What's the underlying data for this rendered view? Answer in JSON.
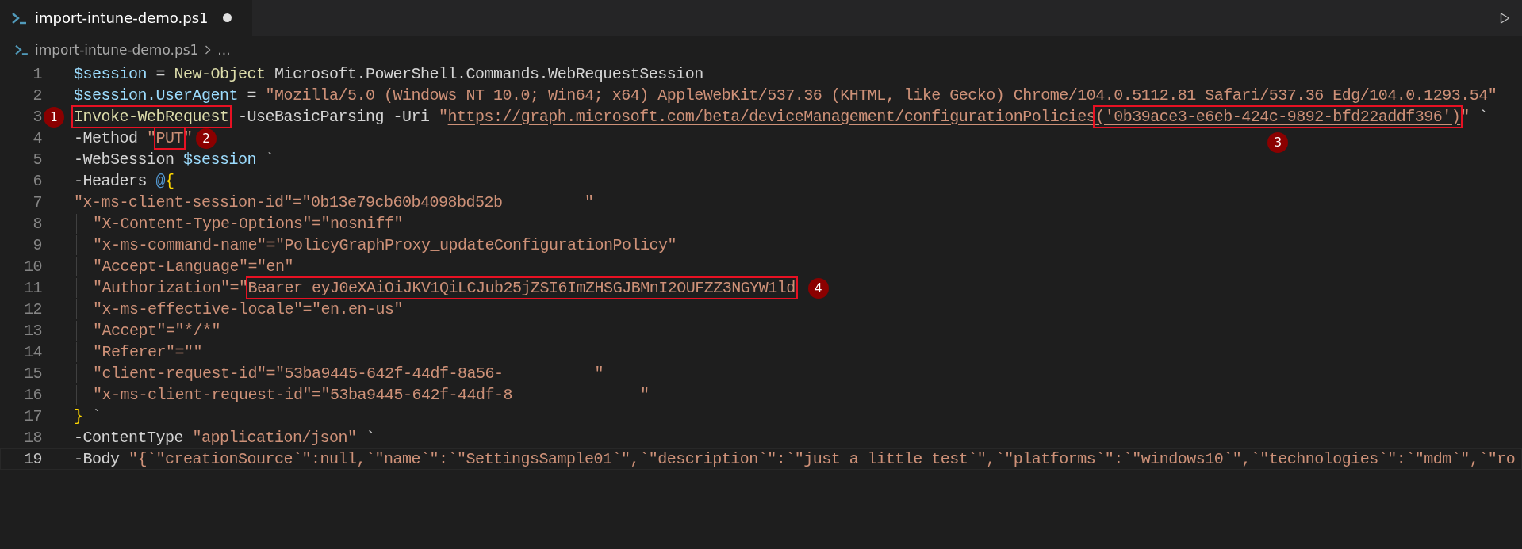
{
  "tab": {
    "title": "import-intune-demo.ps1",
    "modified": true,
    "selected": true
  },
  "breadcrumb": {
    "file": "import-intune-demo.ps1",
    "more": "..."
  },
  "lines": [
    {
      "number": "1",
      "indented": false,
      "current": false,
      "tokens": [
        {
          "kind": "variable",
          "text": "$session"
        },
        {
          "kind": "plain",
          "text": " = "
        },
        {
          "kind": "command",
          "text": "New-Object"
        },
        {
          "kind": "plain",
          "text": " Microsoft.PowerShell.Commands.WebRequestSession"
        }
      ]
    },
    {
      "number": "2",
      "indented": false,
      "current": false,
      "tokens": [
        {
          "kind": "variable",
          "text": "$session.UserAgent"
        },
        {
          "kind": "plain",
          "text": " = "
        },
        {
          "kind": "string",
          "text": "\"Mozilla/5.0 (Windows NT 10.0; Win64; x64) AppleWebKit/537.36 (KHTML, like Gecko) Chrome/104.0.5112.81 Safari/537.36 Edg/104.0.1293.54\""
        }
      ]
    },
    {
      "number": "3",
      "indented": false,
      "current": false,
      "tokens": [
        {
          "kind": "command",
          "text": "Invoke-WebRequest",
          "callout": "1",
          "callout_left": true
        },
        {
          "kind": "plain",
          "text": " -UseBasicParsing -Uri "
        },
        {
          "kind": "string",
          "text": "\""
        },
        {
          "kind": "link",
          "text": "https://graph.microsoft.com/beta/deviceManagement/configurationPolicies"
        },
        {
          "kind": "link",
          "text": "('0b39ace3-e6eb-424c-9892-bfd22addf396')",
          "callout": "3",
          "callout_below": true
        },
        {
          "kind": "string",
          "text": "\""
        },
        {
          "kind": "plain",
          "text": " `"
        }
      ]
    },
    {
      "number": "4",
      "indented": false,
      "current": false,
      "tokens": [
        {
          "kind": "plain",
          "text": "-Method "
        },
        {
          "kind": "string",
          "text": "\""
        },
        {
          "kind": "string",
          "text": "PUT",
          "callout": "2"
        },
        {
          "kind": "string",
          "text": "\""
        }
      ]
    },
    {
      "number": "5",
      "indented": false,
      "current": false,
      "tokens": [
        {
          "kind": "plain",
          "text": "-WebSession "
        },
        {
          "kind": "variable",
          "text": "$session"
        },
        {
          "kind": "plain",
          "text": " `"
        }
      ]
    },
    {
      "number": "6",
      "indented": false,
      "current": false,
      "tokens": [
        {
          "kind": "plain",
          "text": "-Headers "
        },
        {
          "kind": "operator",
          "text": "@"
        },
        {
          "kind": "brace",
          "text": "{"
        }
      ]
    },
    {
      "number": "7",
      "indented": false,
      "current": false,
      "tokens": [
        {
          "kind": "string",
          "text": "\"x-ms-client-session-id\"=\"0b13e79cb60b4098bd52b         \""
        }
      ]
    },
    {
      "number": "8",
      "indented": true,
      "current": false,
      "tokens": [
        {
          "kind": "string",
          "text": "\"X-Content-Type-Options\"=\"nosniff\""
        }
      ]
    },
    {
      "number": "9",
      "indented": true,
      "current": false,
      "tokens": [
        {
          "kind": "string",
          "text": "\"x-ms-command-name\"=\"PolicyGraphProxy_updateConfigurationPolicy\""
        }
      ]
    },
    {
      "number": "10",
      "indented": true,
      "current": false,
      "tokens": [
        {
          "kind": "string",
          "text": "\"Accept-Language\"=\"en\""
        }
      ]
    },
    {
      "number": "11",
      "indented": true,
      "current": false,
      "tokens": [
        {
          "kind": "string",
          "text": "\"Authorization\"=\""
        },
        {
          "kind": "string",
          "text": "Bearer eyJ0eXAiOiJKV1QiLCJub25jZSI6ImZHSGJBMnI2OUFZZ3NGYW1ld",
          "callout": "4"
        }
      ]
    },
    {
      "number": "12",
      "indented": true,
      "current": false,
      "tokens": [
        {
          "kind": "string",
          "text": "\"x-ms-effective-locale\"=\"en.en-us\""
        }
      ]
    },
    {
      "number": "13",
      "indented": true,
      "current": false,
      "tokens": [
        {
          "kind": "string",
          "text": "\"Accept\"=\"*/*\""
        }
      ]
    },
    {
      "number": "14",
      "indented": true,
      "current": false,
      "tokens": [
        {
          "kind": "string",
          "text": "\"Referer\"=\"\""
        }
      ]
    },
    {
      "number": "15",
      "indented": true,
      "current": false,
      "tokens": [
        {
          "kind": "string",
          "text": "\"client-request-id\"=\"53ba9445-642f-44df-8a56-          \""
        }
      ]
    },
    {
      "number": "16",
      "indented": true,
      "current": false,
      "tokens": [
        {
          "kind": "string",
          "text": "\"x-ms-client-request-id\"=\"53ba9445-642f-44df-8              \""
        }
      ]
    },
    {
      "number": "17",
      "indented": false,
      "current": false,
      "tokens": [
        {
          "kind": "brace",
          "text": "}"
        },
        {
          "kind": "plain",
          "text": " `"
        }
      ]
    },
    {
      "number": "18",
      "indented": false,
      "current": false,
      "tokens": [
        {
          "kind": "plain",
          "text": "-ContentType "
        },
        {
          "kind": "string",
          "text": "\"application/json\""
        },
        {
          "kind": "plain",
          "text": " `"
        }
      ]
    },
    {
      "number": "19",
      "indented": false,
      "current": true,
      "tokens": [
        {
          "kind": "plain",
          "text": "-Body "
        },
        {
          "kind": "string",
          "text": "\"{`\"creationSource`\":null,`\"name`\":`\"SettingsSample01`\",`\"description`\":`\"just a little test`\",`\"platforms`\":`\"windows10`\",`\"technologies`\":`\"mdm`\",`\"ro"
        }
      ]
    }
  ]
}
